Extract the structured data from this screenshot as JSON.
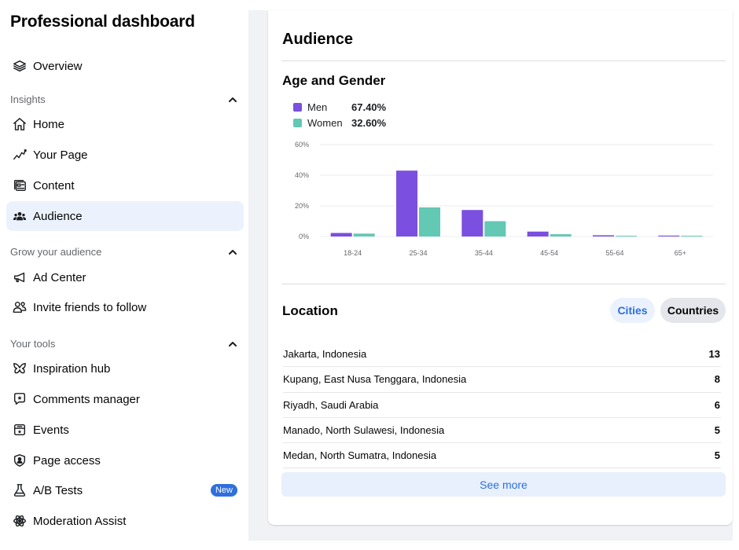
{
  "sidebar": {
    "title": "Professional dashboard",
    "overview": {
      "label": "Overview",
      "icon": "layers-icon"
    },
    "sections": [
      {
        "label": "Insights",
        "items": [
          {
            "label": "Home",
            "icon": "home-icon"
          },
          {
            "label": "Your Page",
            "icon": "line-chart-icon"
          },
          {
            "label": "Content",
            "icon": "content-icon"
          },
          {
            "label": "Audience",
            "icon": "people-icon",
            "active": true
          }
        ]
      },
      {
        "label": "Grow your audience",
        "items": [
          {
            "label": "Ad Center",
            "icon": "megaphone-icon"
          },
          {
            "label": "Invite friends to follow",
            "icon": "invite-friends-icon"
          }
        ]
      },
      {
        "label": "Your tools",
        "items": [
          {
            "label": "Inspiration hub",
            "icon": "butterfly-icon"
          },
          {
            "label": "Comments manager",
            "icon": "comment-star-icon"
          },
          {
            "label": "Events",
            "icon": "calendar-star-icon"
          },
          {
            "label": "Page access",
            "icon": "shield-person-icon"
          },
          {
            "label": "A/B Tests",
            "icon": "flask-icon",
            "badge": "New"
          },
          {
            "label": "Moderation Assist",
            "icon": "atom-gear-icon"
          }
        ]
      }
    ]
  },
  "main": {
    "title": "Audience",
    "age_gender": {
      "title": "Age and Gender",
      "legend": [
        {
          "name": "Men",
          "value": "67.40%",
          "color": "#7b4fe0"
        },
        {
          "name": "Women",
          "value": "32.60%",
          "color": "#63c8b4"
        }
      ]
    },
    "location": {
      "title": "Location",
      "toggle": {
        "cities": "Cities",
        "countries": "Countries",
        "selected": "Cities"
      },
      "rows": [
        {
          "place": "Jakarta, Indonesia",
          "count": "13"
        },
        {
          "place": "Kupang, East Nusa Tenggara, Indonesia",
          "count": "8"
        },
        {
          "place": "Riyadh, Saudi Arabia",
          "count": "6"
        },
        {
          "place": "Manado, North Sulawesi, Indonesia",
          "count": "5"
        },
        {
          "place": "Medan, North Sumatra, Indonesia",
          "count": "5"
        }
      ],
      "see_more": "See more"
    }
  },
  "chart_data": {
    "type": "bar",
    "title": "Age and Gender",
    "xlabel": "",
    "ylabel": "",
    "categories": [
      "18-24",
      "25-34",
      "35-44",
      "45-54",
      "55-64",
      "65+"
    ],
    "series": [
      {
        "name": "Men",
        "color": "#7b4fe0",
        "values": [
          2.3,
          43.0,
          17.3,
          3.2,
          0.8,
          0.6
        ]
      },
      {
        "name": "Women",
        "color": "#63c8b4",
        "values": [
          1.9,
          19.0,
          10.0,
          1.5,
          0.5,
          0.5
        ]
      }
    ],
    "ylim": [
      0,
      60
    ],
    "yticks": [
      0,
      20,
      40,
      60
    ],
    "ytick_labels": [
      "0%",
      "20%",
      "40%",
      "60%"
    ],
    "grid": true,
    "legend": "top-left"
  }
}
